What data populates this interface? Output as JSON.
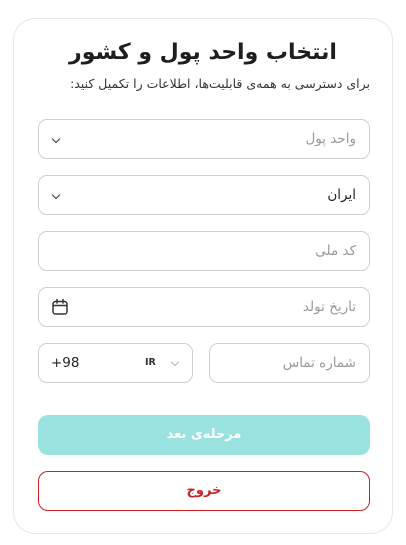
{
  "header": {
    "title": "انتخاب واحد پول و کشور",
    "subtitle": "برای دسترسی به همه‌ی قابلیت‌ها، اطلاعات را تکمیل کنید:"
  },
  "form": {
    "currency": {
      "placeholder": "واحد پول",
      "icon": "chevron-down-icon"
    },
    "country": {
      "value": "ایران",
      "icon": "chevron-down-icon"
    },
    "national_code": {
      "placeholder": "کد ملی"
    },
    "birth_date": {
      "placeholder": "تاریخ تولد",
      "icon": "calendar-icon"
    },
    "phone": {
      "placeholder": "شماره تماس"
    },
    "phone_code": {
      "country_code": "IR",
      "dial_code": "+98",
      "icon": "chevron-down-icon"
    }
  },
  "actions": {
    "next_label": "مرحله‌ی بعد",
    "exit_label": "خروج"
  },
  "colors": {
    "primary_disabled": "#9ae2df",
    "danger": "#cc1f1f",
    "border": "#cfcfcf"
  }
}
